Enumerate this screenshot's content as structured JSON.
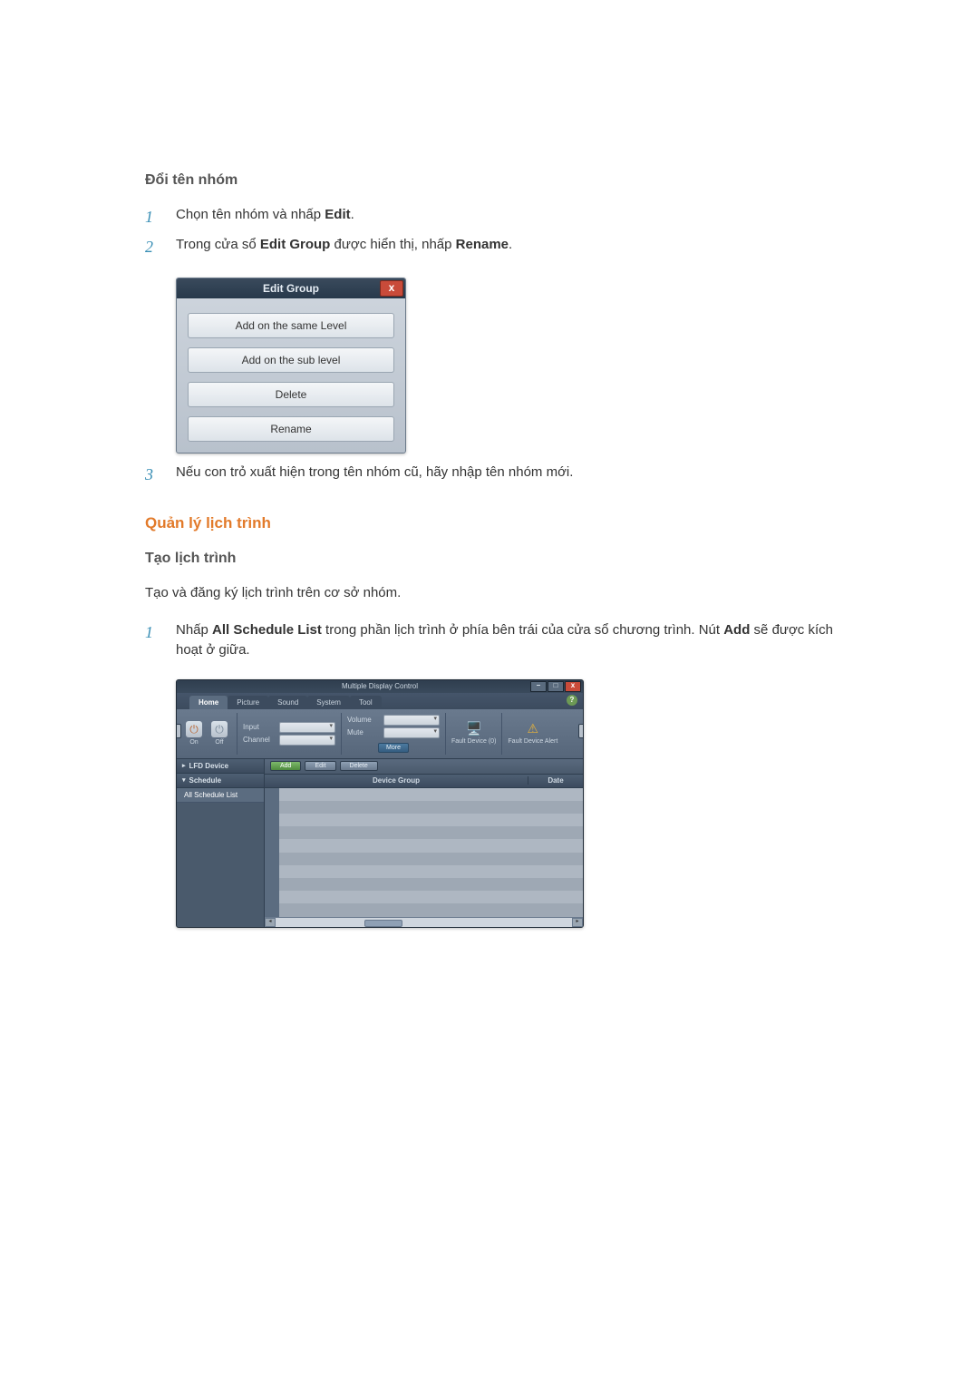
{
  "section1": {
    "heading": "Đổi tên nhóm",
    "step1_pre": "Chọn tên nhóm và nhấp ",
    "step1_bold": "Edit",
    "step1_post": ".",
    "step2_pre": "Trong cửa sổ ",
    "step2_bold1": "Edit Group",
    "step2_mid": " được hiển thị, nhấp ",
    "step2_bold2": "Rename",
    "step2_post": ".",
    "step3": "Nếu con trỏ xuất hiện trong tên nhóm cũ, hãy nhập tên nhóm mới."
  },
  "edit_dialog": {
    "title": "Edit Group",
    "close_glyph": "x",
    "options": {
      "same_level": "Add on the same Level",
      "sub_level": "Add on the sub level",
      "delete": "Delete",
      "rename": "Rename"
    }
  },
  "section2": {
    "heading": "Quản lý lịch trình",
    "subheading": "Tạo lịch trình",
    "intro": "Tạo và đăng ký lịch trình trên cơ sở nhóm.",
    "step1_pre": "Nhấp ",
    "step1_bold1": "All Schedule List",
    "step1_mid": " trong phần lịch trình ở phía bên trái của cửa sổ chương trình. Nút ",
    "step1_bold2": "Add",
    "step1_post": " sẽ được kích hoạt ở giữa."
  },
  "nums": {
    "n1": "1",
    "n2": "2",
    "n3": "3"
  },
  "mdc": {
    "window_title": "Multiple Display Control",
    "win_btns": {
      "min": "–",
      "max": "□",
      "close": "x"
    },
    "help_glyph": "?",
    "tabs": {
      "home": "Home",
      "picture": "Picture",
      "sound": "Sound",
      "system": "System",
      "tool": "Tool"
    },
    "power": {
      "on": "On",
      "off": "Off",
      "glyph": "⏻"
    },
    "input": {
      "label": "Input",
      "value": ""
    },
    "channel": {
      "label": "Channel",
      "value": ""
    },
    "volume": {
      "label": "Volume",
      "value": ""
    },
    "mute": {
      "label": "Mute",
      "value": ""
    },
    "more": "More",
    "fault0": {
      "icon": "🖥️",
      "label": "Fault Device (0)"
    },
    "alert": {
      "icon": "⚠",
      "label": "Fault Device Alert"
    },
    "sidebar": {
      "lfd": "LFD Device",
      "schedule": "Schedule",
      "all_list": "All Schedule List",
      "chev_right": "▸",
      "chev_down": "▾"
    },
    "toolbar": {
      "add": "Add",
      "edit": "Edit",
      "delete": "Delete"
    },
    "grid": {
      "group": "Device Group",
      "date": "Date"
    },
    "scroll": {
      "left": "◂",
      "right": "▸"
    }
  }
}
